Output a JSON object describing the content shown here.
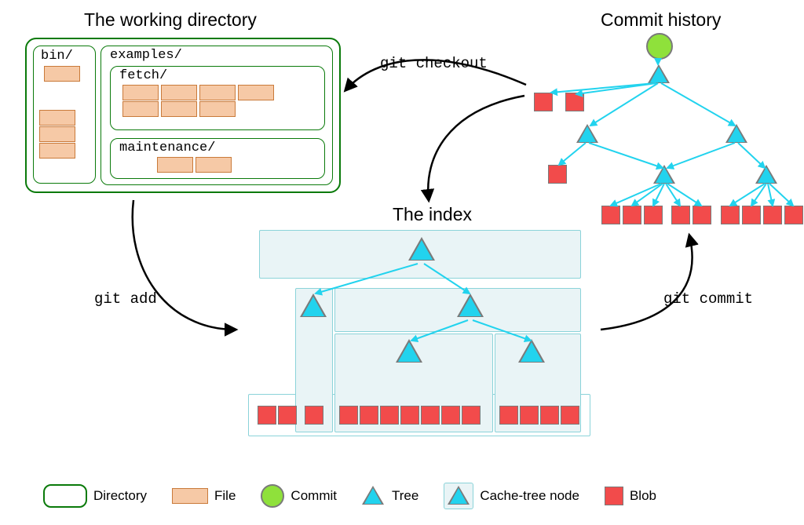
{
  "titles": {
    "working": "The working directory",
    "index": "The index",
    "history": "Commit history"
  },
  "commands": {
    "checkout": "git checkout",
    "add": "git add",
    "commit": "git commit"
  },
  "dirs": {
    "bin": "bin/",
    "examples": "examples/",
    "fetch": "fetch/",
    "maintenance": "maintenance/"
  },
  "legend": {
    "directory": "Directory",
    "file": "File",
    "commit": "Commit",
    "tree": "Tree",
    "cache": "Cache-tree node",
    "blob": "Blob"
  },
  "colors": {
    "dir_border": "#0a7a0a",
    "file_fill": "#f6c9a6",
    "file_border": "#c97a3a",
    "index_border": "#8bd3d9",
    "index_fill": "#e9f4f6",
    "tree_fill": "#22d3ee",
    "shape_outline": "#7a7a7a",
    "blob_fill": "#f24b4b",
    "commit_fill": "#8fe13b",
    "arrow": "#000000",
    "history_edge": "#22d3ee"
  }
}
